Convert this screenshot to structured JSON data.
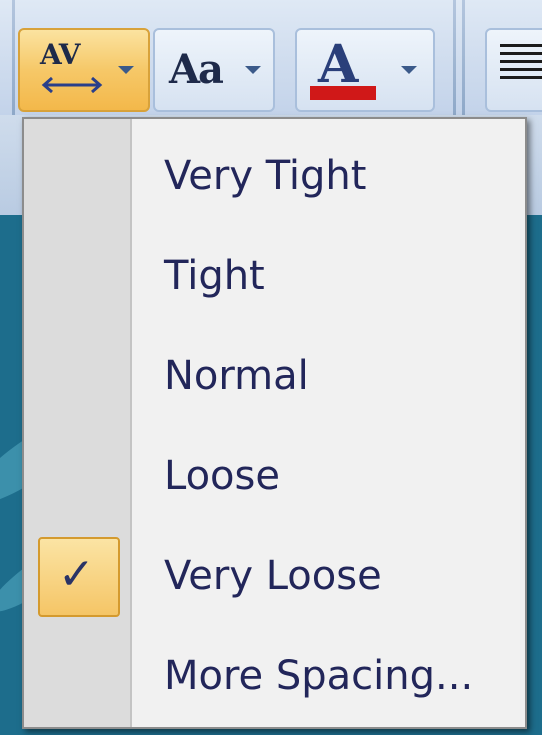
{
  "ribbon": {
    "character_spacing_icon": "AV",
    "change_case_icon": "Aa",
    "font_color_icon": "A"
  },
  "menu": {
    "items": [
      {
        "label": "Very Tight",
        "checked": false
      },
      {
        "label": "Tight",
        "checked": false
      },
      {
        "label": "Normal",
        "checked": false
      },
      {
        "label": "Loose",
        "checked": false
      },
      {
        "label": "Very Loose",
        "checked": true
      },
      {
        "label": "More Spacing...",
        "checked": false
      }
    ],
    "check_glyph": "✓"
  },
  "colors": {
    "font_color": "#d01818",
    "highlight": "#f6c868"
  }
}
